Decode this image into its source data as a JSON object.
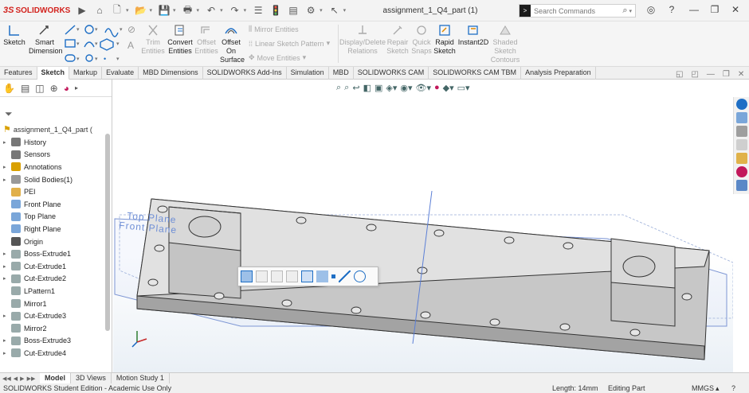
{
  "app": {
    "logo_text": "SOLIDWORKS",
    "logo_prefix": "3S",
    "document_title": "assignment_1_Q4_part (1)",
    "search_placeholder": "Search Commands"
  },
  "ribbon": {
    "sketch": "Sketch",
    "smart_dimension_1": "Smart",
    "smart_dimension_2": "Dimension",
    "trim_entities_1": "Trim",
    "trim_entities_2": "Entities",
    "convert_entities_1": "Convert",
    "convert_entities_2": "Entities",
    "offset_entities_1": "Offset",
    "offset_entities_2": "Entities",
    "offset_on_surface_1": "Offset",
    "offset_on_surface_2": "On",
    "offset_on_surface_3": "Surface",
    "mirror_entities": "Mirror Entities",
    "linear_sketch_pattern": "Linear Sketch Pattern",
    "move_entities": "Move Entities",
    "display_delete_1": "Display/Delete",
    "display_delete_2": "Relations",
    "repair_sketch_1": "Repair",
    "repair_sketch_2": "Sketch",
    "quick_snaps_1": "Quick",
    "quick_snaps_2": "Snaps",
    "rapid_sketch_1": "Rapid",
    "rapid_sketch_2": "Sketch",
    "instant2d": "Instant2D",
    "shaded_contours_1": "Shaded",
    "shaded_contours_2": "Sketch",
    "shaded_contours_3": "Contours"
  },
  "tabs": [
    "Features",
    "Sketch",
    "Markup",
    "Evaluate",
    "MBD Dimensions",
    "SOLIDWORKS Add-Ins",
    "Simulation",
    "MBD",
    "SOLIDWORKS CAM",
    "SOLIDWORKS CAM TBM",
    "Analysis Preparation"
  ],
  "active_tab": "Sketch",
  "tree": {
    "root": "assignment_1_Q4_part (",
    "items": [
      {
        "label": "History",
        "expandable": true
      },
      {
        "label": "Sensors",
        "expandable": false
      },
      {
        "label": "Annotations",
        "expandable": true
      },
      {
        "label": "Solid Bodies(1)",
        "expandable": true
      },
      {
        "label": "PEI",
        "expandable": false
      },
      {
        "label": "Front Plane",
        "expandable": false
      },
      {
        "label": "Top Plane",
        "expandable": false
      },
      {
        "label": "Right Plane",
        "expandable": false
      },
      {
        "label": "Origin",
        "expandable": false
      },
      {
        "label": "Boss-Extrude1",
        "expandable": true
      },
      {
        "label": "Cut-Extrude1",
        "expandable": true
      },
      {
        "label": "Cut-Extrude2",
        "expandable": true
      },
      {
        "label": "LPattern1",
        "expandable": false
      },
      {
        "label": "Mirror1",
        "expandable": false
      },
      {
        "label": "Cut-Extrude3",
        "expandable": true
      },
      {
        "label": "Mirror2",
        "expandable": false
      },
      {
        "label": "Boss-Extrude3",
        "expandable": true
      },
      {
        "label": "Cut-Extrude4",
        "expandable": true
      }
    ]
  },
  "viewport": {
    "top_plane_label": "Top Plane",
    "front_plane_label": "Front Plane"
  },
  "bottom_tabs": [
    "Model",
    "3D Views",
    "Motion Study 1"
  ],
  "active_bottom_tab": "Model",
  "status": {
    "edition": "SOLIDWORKS Student Edition - Academic Use Only",
    "length": "Length: 14mm",
    "mode": "Editing Part",
    "units": "MMGS"
  },
  "colors": {
    "accent": "#1f6fc5",
    "plane": "#5b7fd6",
    "part_top": "#dedede",
    "part_side": "#a9a9a9",
    "brand_red": "#d3231e"
  }
}
